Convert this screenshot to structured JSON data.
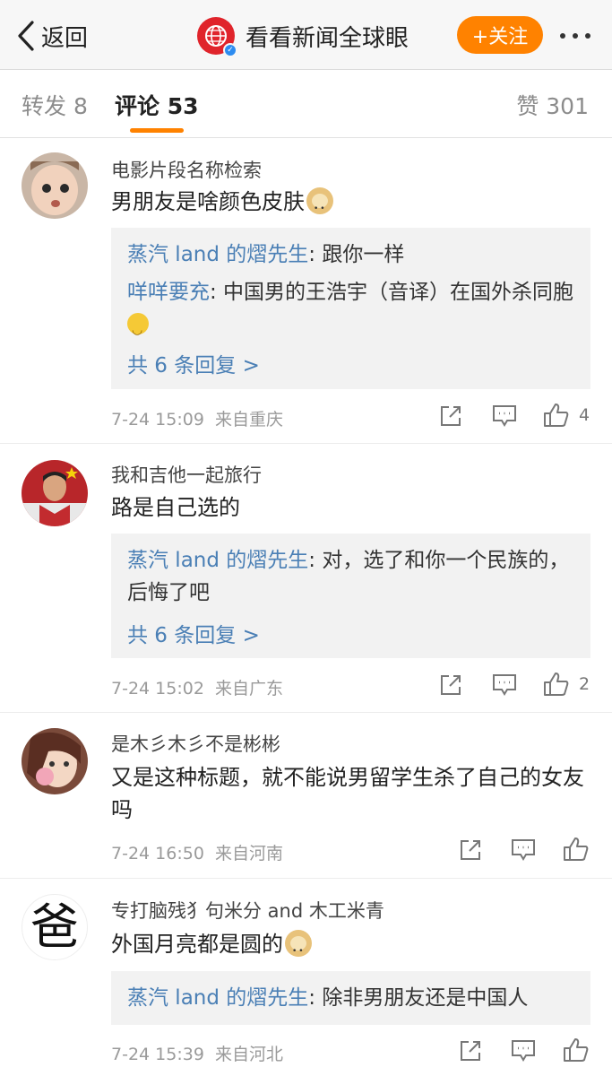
{
  "nav": {
    "back_label": "返回",
    "account_name": "看看新闻全球眼",
    "follow_label": "+关注"
  },
  "tabs": {
    "repost": "转发 8",
    "comment": "评论 53",
    "like": "赞 301"
  },
  "comments": [
    {
      "user": "电影片段名称检索",
      "text": "男朋友是啥颜色皮肤",
      "replies": [
        {
          "name": "蒸汽 land 的熠先生",
          "text": ": 跟你一样"
        },
        {
          "name": "咩咩要充",
          "text": ": 中国男的王浩宇（音译）在国外杀同胞"
        }
      ],
      "more_replies": "共 6 条回复 >",
      "time": "7-24 15:09",
      "location": "来自重庆",
      "like_count": "4"
    },
    {
      "user": "我和吉他一起旅行",
      "text": "路是自己选的",
      "replies": [
        {
          "name": "蒸汽 land 的熠先生",
          "text": ": 对，选了和你一个民族的，后悔了吧"
        }
      ],
      "more_replies": "共 6 条回复 >",
      "time": "7-24 15:02",
      "location": "来自广东",
      "like_count": "2"
    },
    {
      "user": "是木彡木彡不是彬彬",
      "text": "又是这种标题，就不能说男留学生杀了自己的女友吗",
      "time": "7-24 16:50",
      "location": "来自河南",
      "like_count": ""
    },
    {
      "user": "专打脑残犭句米分 and 木工米青",
      "avatar_char": "爸",
      "text": "外国月亮都是圆的",
      "replies": [
        {
          "name": "蒸汽 land 的熠先生",
          "text": ": 除非男朋友还是中国人"
        }
      ],
      "time": "7-24 15:39",
      "location": "来自河北",
      "like_count": ""
    }
  ],
  "colors": {
    "accent_orange": "#ff8200",
    "link_blue": "#4a7fb5",
    "reply_bg": "#f2f2f2"
  },
  "icons": [
    "back-chevron-icon",
    "globe-logo-icon",
    "verified-icon",
    "more-dots-icon",
    "share-icon",
    "comment-icon",
    "thumbs-up-icon",
    "doge-emoji",
    "smile-emoji"
  ]
}
